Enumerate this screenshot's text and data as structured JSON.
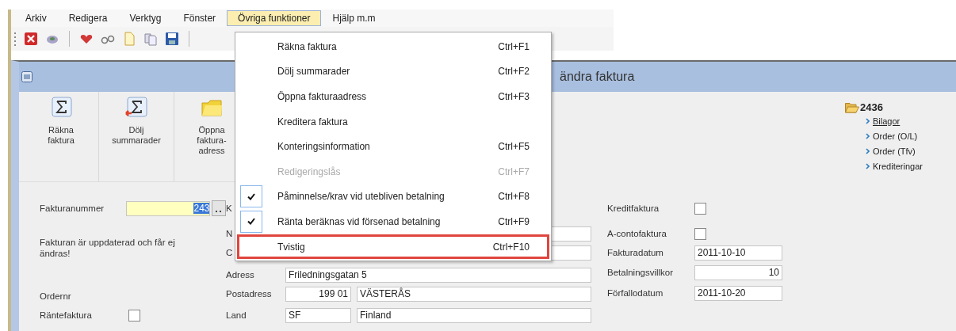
{
  "menu_bar": [
    {
      "label": "Arkiv",
      "selected": false
    },
    {
      "label": "Redigera",
      "selected": false
    },
    {
      "label": "Verktyg",
      "selected": false
    },
    {
      "label": "Fönster",
      "selected": false
    },
    {
      "label": "Övriga funktioner",
      "selected": true
    },
    {
      "label": "Hjälp m.m",
      "selected": false
    }
  ],
  "dropdown": [
    {
      "label": "Räkna faktura",
      "shortcut": "Ctrl+F1",
      "checked": false,
      "disabled": false,
      "highlighted": false
    },
    {
      "label": "Dölj summarader",
      "shortcut": "Ctrl+F2",
      "checked": false,
      "disabled": false,
      "highlighted": false
    },
    {
      "label": "Öppna fakturaadress",
      "shortcut": "Ctrl+F3",
      "checked": false,
      "disabled": false,
      "highlighted": false
    },
    {
      "label": "Kreditera faktura",
      "checked": false,
      "disabled": false,
      "highlighted": false
    },
    {
      "label": "Konteringsinformation",
      "shortcut": "Ctrl+F5",
      "checked": false,
      "disabled": false,
      "highlighted": false
    },
    {
      "label": "Redigeringslås",
      "shortcut": "Ctrl+F7",
      "checked": false,
      "disabled": true,
      "highlighted": false
    },
    {
      "label": "Påminnelse/krav vid utebliven betalning",
      "shortcut": "Ctrl+F8",
      "checked": true,
      "disabled": false,
      "highlighted": false
    },
    {
      "label": "Ränta beräknas vid försenad betalning",
      "shortcut": "Ctrl+F9",
      "checked": true,
      "disabled": false,
      "highlighted": false
    },
    {
      "label": "Tvistig",
      "shortcut": "Ctrl+F10",
      "checked": false,
      "disabled": false,
      "highlighted": true
    }
  ],
  "window": {
    "title": "ändra faktura"
  },
  "ribbon": [
    {
      "kind": "sum",
      "lines": [
        "Räkna",
        "faktura"
      ]
    },
    {
      "kind": "hide-sum",
      "lines": [
        "Dölj",
        "summarader"
      ]
    },
    {
      "kind": "folder",
      "lines": [
        "Öppna",
        "faktura-",
        "adress"
      ]
    }
  ],
  "record": {
    "number": "2436",
    "links": [
      {
        "label": "Bilagor",
        "underlined": true
      },
      {
        "label": "Order (O/L)",
        "underlined": false
      },
      {
        "label": "Order (Tfv)",
        "underlined": false
      },
      {
        "label": "Krediteringar",
        "underlined": false
      }
    ]
  },
  "invoice_number": {
    "label": "Fakturanummer",
    "value": "243",
    "selected": true
  },
  "notice": "Fakturan är uppdaterad och får ej ändras!",
  "order_number": {
    "label": "Ordernr"
  },
  "interest_invoice": {
    "label": "Räntefaktura",
    "checked": false
  },
  "middle_rows": [
    {
      "kind": "label",
      "label": "K"
    },
    {
      "kind": "field",
      "label": "N"
    },
    {
      "kind": "field",
      "label": "C"
    },
    {
      "kind": "field",
      "label": "Adress",
      "values": [
        {
          "text": "Friledningsgatan 5",
          "right_aligned": false
        }
      ]
    },
    {
      "kind": "split",
      "label": "Postadress",
      "values": [
        {
          "text": "199 01",
          "right_aligned": true
        },
        {
          "text": "VÄSTERÅS",
          "right_aligned": false
        }
      ]
    },
    {
      "kind": "split",
      "label": "Land",
      "values": [
        {
          "text": "SF",
          "right_aligned": false
        },
        {
          "text": "Finland",
          "right_aligned": false
        }
      ]
    }
  ],
  "right_rows": [
    {
      "kind": "checkbox",
      "label": "Kreditfaktura",
      "checked": false
    },
    {
      "kind": "checkbox",
      "label": "A-contofaktura",
      "checked": false
    },
    {
      "kind": "field",
      "label": "Fakturadatum",
      "value": "2011-10-10",
      "right_aligned": false
    },
    {
      "kind": "field",
      "label": "Betalningsvillkor",
      "value": "10",
      "right_aligned": true
    },
    {
      "kind": "field",
      "label": "Förfallodatum",
      "value": "2011-10-20",
      "right_aligned": false
    }
  ]
}
